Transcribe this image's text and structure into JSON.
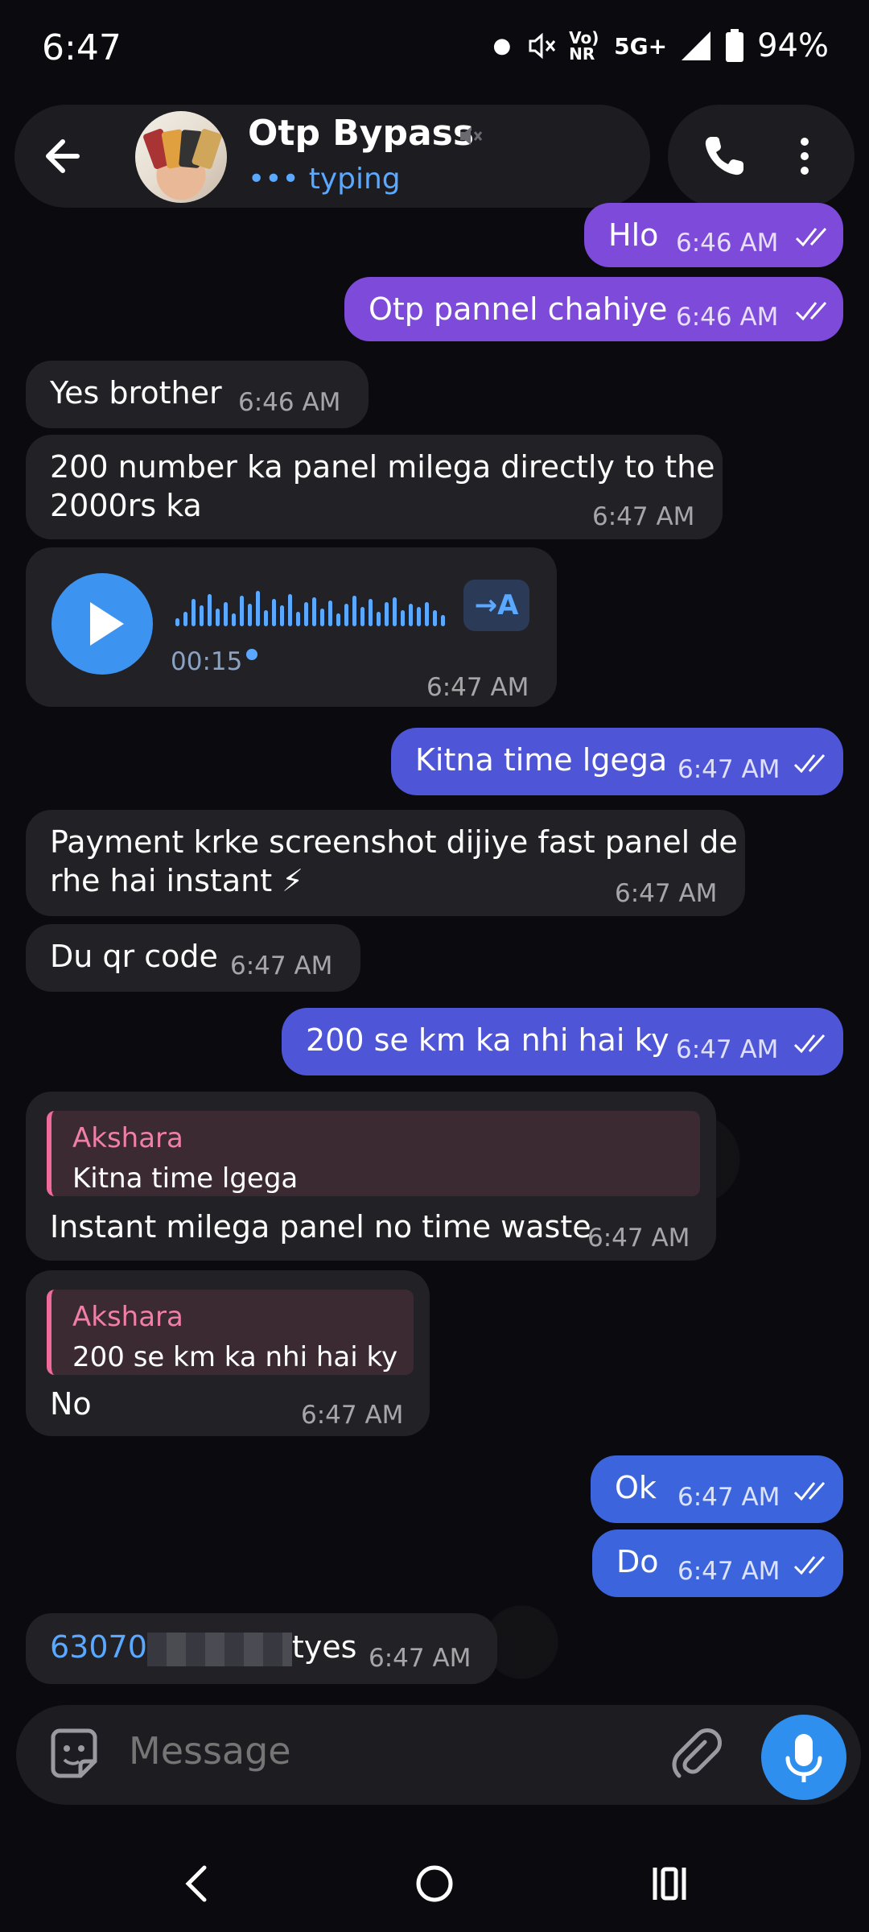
{
  "status_bar": {
    "time": "6:47",
    "carrier": "Vo) NR",
    "network": "5G+",
    "battery": "94%"
  },
  "header": {
    "back_icon": "arrow-left-icon",
    "title": "Otp Bypass",
    "muted_icon": "speaker-muted-icon",
    "status_dots": "•••",
    "status": "typing",
    "call_icon": "phone-icon",
    "menu_icon": "more-vertical-icon"
  },
  "messages": [
    {
      "dir": "out",
      "text": "Hlo",
      "time": "6:46 AM"
    },
    {
      "dir": "out",
      "text": "Otp pannel chahiye",
      "time": "6:46 AM"
    },
    {
      "dir": "in",
      "text": "Yes brother",
      "time": "6:46 AM"
    },
    {
      "dir": "in",
      "line1": "200 number ka panel milega directly to the",
      "line2": "2000rs ka",
      "time": "6:47 AM"
    },
    {
      "dir": "in",
      "type": "voice",
      "duration": "00:15",
      "translate": "→A",
      "time": "6:47 AM"
    },
    {
      "dir": "out",
      "text": "Kitna time lgega",
      "time": "6:47 AM"
    },
    {
      "dir": "in",
      "line1": "Payment krke screenshot dijiye fast panel de",
      "line2": "rhe hai instant ⚡",
      "time": "6:47 AM"
    },
    {
      "dir": "in",
      "text": "Du qr code",
      "time": "6:47 AM"
    },
    {
      "dir": "out",
      "text": "200 se km ka nhi hai ky",
      "time": "6:47 AM"
    },
    {
      "dir": "in",
      "reply_name": "Akshara",
      "reply_text": "Kitna time lgega",
      "text": "Instant milega panel no time waste",
      "time": "6:47 AM"
    },
    {
      "dir": "in",
      "reply_name": "Akshara",
      "reply_text": "200 se km ka nhi hai ky",
      "text": "No",
      "time": "6:47 AM"
    },
    {
      "dir": "out",
      "text": "Ok",
      "time": "6:47 AM"
    },
    {
      "dir": "out",
      "text": "Do",
      "time": "6:47 AM"
    },
    {
      "dir": "in",
      "link_prefix": "63070",
      "suffix": "tyes",
      "time": "6:47 AM"
    }
  ],
  "composer": {
    "emoji_icon": "sticker-icon",
    "placeholder": "Message",
    "attach_icon": "paperclip-icon",
    "mic_icon": "microphone-icon"
  },
  "nav_bar": {
    "back": "chevron-left-icon",
    "home": "circle-home-icon",
    "recents": "recents-icon"
  },
  "colors": {
    "background": "#0b0b0f",
    "incoming": "#212126",
    "outgoing_purple": "#7d4ad9",
    "outgoing_blue": "#3c65dd",
    "accent": "#5aa8ff",
    "reply_name": "#f07fa6"
  }
}
